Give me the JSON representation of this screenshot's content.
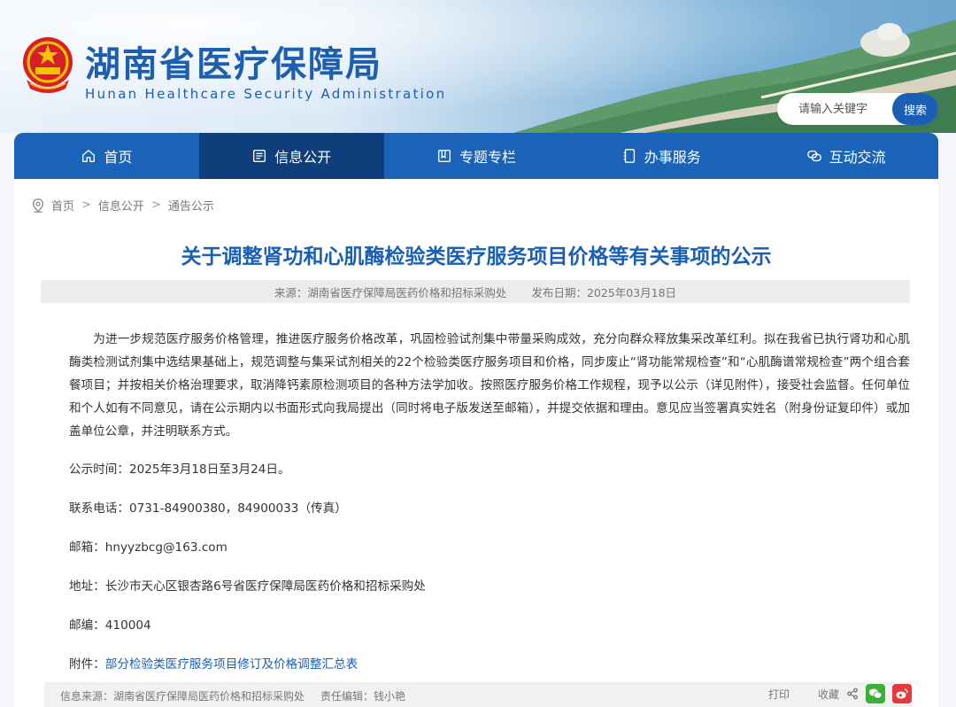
{
  "header": {
    "title": "湖南省医疗保障局",
    "subtitle": "Hunan Healthcare Security Administration",
    "search": {
      "placeholder": "请输入关键字",
      "button": "搜索"
    }
  },
  "nav": {
    "items": [
      {
        "label": "首页",
        "icon": "home-icon"
      },
      {
        "label": "信息公开",
        "icon": "document-list-icon",
        "active": true
      },
      {
        "label": "专题专栏",
        "icon": "book-icon"
      },
      {
        "label": "办事服务",
        "icon": "notebook-icon"
      },
      {
        "label": "互动交流",
        "icon": "chat-icon"
      }
    ]
  },
  "breadcrumb": {
    "items": [
      "首页",
      "信息公开",
      "通告公示"
    ],
    "separator": ">"
  },
  "article": {
    "title": "关于调整肾功和心肌酶检验类医疗服务项目价格等有关事项的公示",
    "source": "来源：湖南省医疗保障局医药价格和招标采购处",
    "date": "发布日期：2025年03月18日",
    "body": "为进一步规范医疗服务价格管理，推进医疗服务价格改革，巩固检验试剂集中带量采购成效，充分向群众释放集采改革红利。拟在我省已执行肾功和心肌酶类检测试剂集中选结果基础上，规范调整与集采试剂相关的22个检验类医疗服务项目和价格，同步废止“肾功能常规检查”和“心肌酶谱常规检查”两个组合套餐项目；并按相关价格治理要求，取消降钙素原检测项目的各种方法学加收。按照医疗服务价格工作规程，现予以公示（详见附件），接受社会监督。任何单位和个人如有不同意见，请在公示期内以书面形式向我局提出（同时将电子版发送至邮箱），并提交依据和理由。意见应当签署真实姓名（附身份证复印件）或加盖单位公章，并注明联系方式。",
    "publicity_time": "公示时间：2025年3月18日至3月24日。",
    "phone": "联系电话：0731-84900380，84900033（传真）",
    "email": "邮箱：hnyyzbcg@163.com",
    "address": "地址：长沙市天心区银杏路6号省医疗保障局医药价格和招标采购处",
    "postcode": "邮编：410004",
    "attachment_label": "附件：",
    "attachment_link": "部分检验类医疗服务项目修订及价格调整汇总表"
  },
  "footer": {
    "info_source": "信息来源：湖南省医疗保障局医药价格和招标采购处",
    "editor": "责任编辑：钱小艳",
    "print": "打印",
    "favorite": "收藏"
  },
  "colors": {
    "primary": "#1a63b8",
    "nav_active": "#0f3f7a",
    "title": "#1a5fb4",
    "wechat": "#3cb034",
    "weibo": "#e6393d"
  }
}
